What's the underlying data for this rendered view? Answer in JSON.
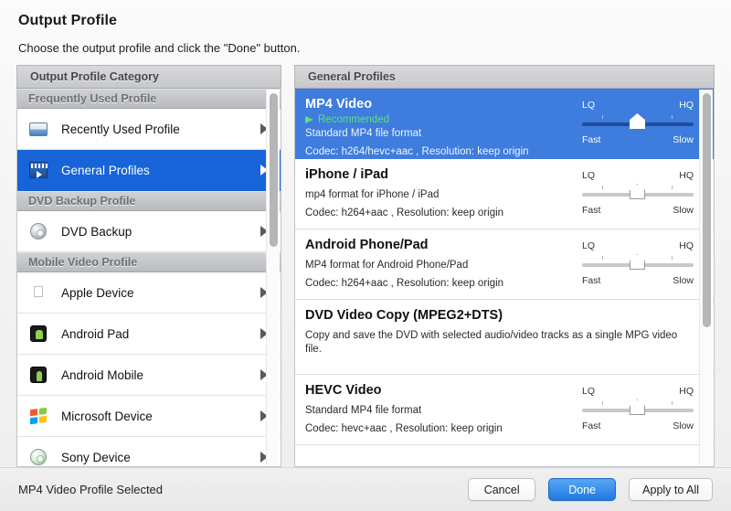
{
  "header": {
    "title": "Output Profile",
    "subtitle": "Choose the output profile and click the \"Done\" button."
  },
  "left_column": {
    "header": "Output Profile Category",
    "groups": [
      {
        "label": "Frequently Used Profile",
        "items": [
          {
            "label": "Recently Used Profile",
            "icon": "tray-icon",
            "selected": false
          },
          {
            "label": "General Profiles",
            "icon": "clapperboard-icon",
            "selected": true
          }
        ]
      },
      {
        "label": "DVD Backup Profile",
        "items": [
          {
            "label": "DVD Backup",
            "icon": "disc-icon",
            "selected": false
          }
        ]
      },
      {
        "label": "Mobile Video Profile",
        "items": [
          {
            "label": "Apple Device",
            "icon": "apple-icon",
            "selected": false
          },
          {
            "label": "Android Pad",
            "icon": "android-pad-icon",
            "selected": false
          },
          {
            "label": "Android Mobile",
            "icon": "android-mobile-icon",
            "selected": false
          },
          {
            "label": "Microsoft Device",
            "icon": "windows-icon",
            "selected": false
          },
          {
            "label": "Sony Device",
            "icon": "sony-icon",
            "selected": false
          }
        ]
      }
    ]
  },
  "right_column": {
    "header": "General Profiles",
    "slider_labels": {
      "lq": "LQ",
      "hq": "HQ",
      "fast": "Fast",
      "slow": "Slow"
    },
    "profiles": [
      {
        "name": "MP4 Video",
        "recommended": "Recommended",
        "description": "Standard MP4 file format",
        "codec": "Codec: h264/hevc+aac , Resolution: keep origin",
        "has_slider": true,
        "selected": true
      },
      {
        "name": "iPhone / iPad",
        "recommended": null,
        "description": "mp4 format for iPhone / iPad",
        "codec": "Codec: h264+aac , Resolution: keep origin",
        "has_slider": true,
        "selected": false
      },
      {
        "name": "Android Phone/Pad",
        "recommended": null,
        "description": "MP4 format for Android Phone/Pad",
        "codec": "Codec: h264+aac , Resolution: keep origin",
        "has_slider": true,
        "selected": false
      },
      {
        "name": "DVD Video Copy (MPEG2+DTS)",
        "recommended": null,
        "description": "Copy and save the DVD with selected audio/video tracks as a single MPG video file.",
        "codec": null,
        "has_slider": false,
        "selected": false
      },
      {
        "name": "HEVC Video",
        "recommended": null,
        "description": "Standard MP4 file format",
        "codec": "Codec: hevc+aac , Resolution: keep origin",
        "has_slider": true,
        "selected": false
      }
    ]
  },
  "footer": {
    "status": "MP4 Video Profile Selected",
    "cancel": "Cancel",
    "done": "Done",
    "apply_all": "Apply to All"
  },
  "colors": {
    "accent_blue": "#1664d8",
    "row_selected_blue": "#3e7cdd",
    "recommended_green": "#5fe07a",
    "primary_button_blue": "#1f7ae0"
  }
}
